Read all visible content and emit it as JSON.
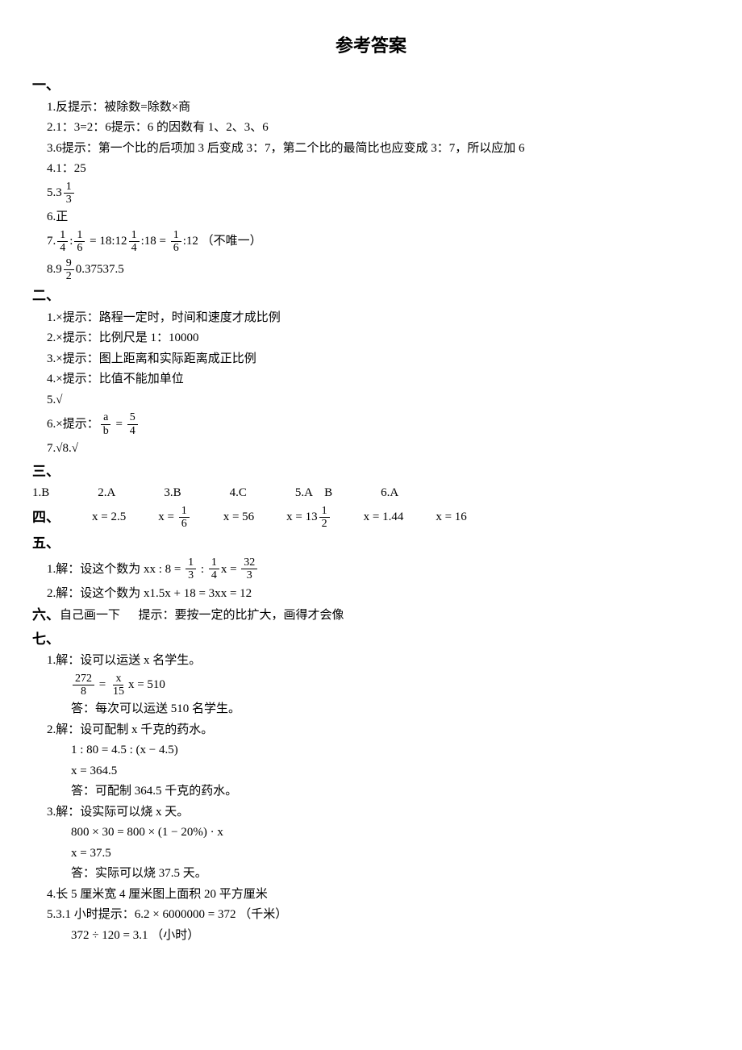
{
  "title": "参考答案",
  "sec1": {
    "h": "一、",
    "i1": {
      "n": "1.",
      "a": "反",
      "hint": "提示：被除数=除数×商"
    },
    "i2": {
      "n": "2.",
      "a": "1：3=2：6",
      "hint": "提示：6 的因数有 1、2、3、6"
    },
    "i3": {
      "n": "3.",
      "a": "6",
      "hint": "提示：第一个比的后项加 3 后变成 3：7，第二个比的最简比也应变成 3：7，所以应加 6"
    },
    "i4": {
      "n": "4.",
      "a": "1：25"
    },
    "i5": {
      "n": "5.",
      "a": "3",
      "fnum": "1",
      "fden": "3"
    },
    "i6": {
      "n": "6.",
      "a": "正"
    },
    "i7": {
      "n": "7.",
      "f1n": "1",
      "f1d": "4",
      "mid1": ":",
      "f2n": "1",
      "f2d": "6",
      "eq1": " = 18:12",
      "f3n": "1",
      "f3d": "4",
      "mid2": ":18 = ",
      "f4n": "1",
      "f4d": "6",
      "eq2": ":12 （不唯一）"
    },
    "i8": {
      "n": "8.",
      "a": "9",
      "fnum": "9",
      "fden": "2",
      "b": "0.375",
      "c": "37.5"
    }
  },
  "sec2": {
    "h": "二、",
    "i1": {
      "n": "1.",
      "a": "×",
      "hint": "提示：路程一定时，时间和速度才成比例"
    },
    "i2": {
      "n": "2.",
      "a": "×",
      "hint": "提示：比例尺是 1：10000"
    },
    "i3": {
      "n": "3.",
      "a": "×",
      "hint": "提示：图上距离和实际距离成正比例"
    },
    "i4": {
      "n": "4.",
      "a": "×",
      "hint": "提示：比值不能加单位"
    },
    "i5": {
      "n": "5.",
      "a": "√"
    },
    "i6": {
      "n": "6.",
      "a": "×",
      "hintpre": "提示：",
      "f1n": "a",
      "f1d": "b",
      "eq": " = ",
      "f2n": "5",
      "f2d": "4"
    },
    "i7": {
      "n": "7.",
      "a": "√",
      "n2": "8.",
      "a2": "√"
    }
  },
  "sec3": {
    "h": "三、",
    "row": [
      {
        "n": "1.",
        "a": "B"
      },
      {
        "n": "2.",
        "a": "A"
      },
      {
        "n": "3.",
        "a": "B"
      },
      {
        "n": "4.",
        "a": "C"
      },
      {
        "n": "5.",
        "a": "A    B"
      },
      {
        "n": "6.",
        "a": "A"
      }
    ]
  },
  "sec4": {
    "h": "四、",
    "items": {
      "a": "x = 2.5",
      "bpre": "x = ",
      "bfn": "1",
      "bfd": "6",
      "c": "x = 56",
      "dpre": "x = 13",
      "dfn": "1",
      "dfd": "2",
      "e": "x = 1.44",
      "f": "x = 16"
    }
  },
  "sec5": {
    "h": "五、",
    "i1": {
      "n": "1.",
      "set": "解：设这个数为 x",
      "eqpre": "x : 8 = ",
      "f1n": "1",
      "f1d": "3",
      "mid": " : ",
      "f2n": "1",
      "f2d": "4",
      "anspre": "x = ",
      "afn": "32",
      "afd": "3"
    },
    "i2": {
      "n": "2.",
      "set": "解：设这个数为 x",
      "eq": "1.5x + 18 = 3x",
      "ans": "x = 12"
    }
  },
  "sec6": {
    "h": "六、",
    "text": "自己画一下      提示：要按一定的比扩大，画得才会像"
  },
  "sec7": {
    "h": "七、",
    "q1": {
      "n": "1.",
      "set": "解：设可以运送 x 名学生。",
      "f1n": "272",
      "f1d": "8",
      "eq": " = ",
      "f2n": "x",
      "f2d": "15",
      "sol": "x = 510",
      "ans": "答：每次可以运送 510 名学生。"
    },
    "q2": {
      "n": "2.",
      "set": "解：设可配制 x 千克的药水。",
      "eq1": "1 : 80 = 4.5 : (x − 4.5)",
      "eq2": "x = 364.5",
      "ans": "答：可配制 364.5 千克的药水。"
    },
    "q3": {
      "n": "3.",
      "set": "解：设实际可以烧 x 天。",
      "eq1": "800 × 30 = 800 × (1 − 20%) · x",
      "eq2": "x = 37.5",
      "ans": "答：实际可以烧 37.5 天。"
    },
    "q4": {
      "n": "4.",
      "a": "长 5 厘米",
      "b": "宽 4 厘米",
      "c": "图上面积 20 平方厘米"
    },
    "q5": {
      "n": "5.",
      "a": "3.1 小时",
      "hint": "提示：",
      "eq1": "6.2 × 6000000 = 372 （千米）",
      "eq2": "372 ÷ 120 = 3.1 （小时）"
    }
  }
}
